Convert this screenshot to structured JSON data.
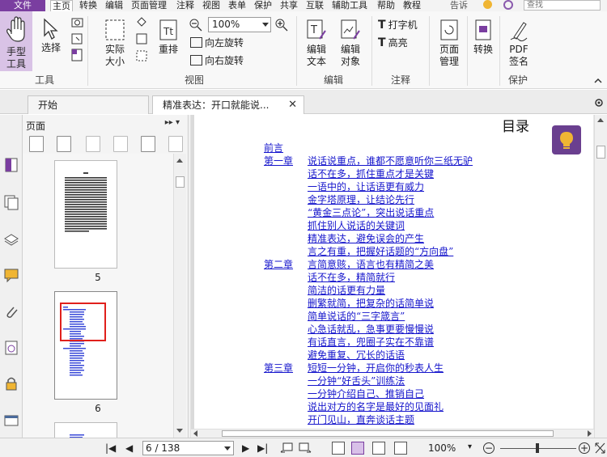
{
  "menubar": {
    "file": "文件",
    "items": [
      "主页",
      "转换",
      "编辑",
      "页面管理",
      "注释",
      "视图",
      "表单",
      "保护",
      "共享",
      "互联",
      "辅助工具",
      "帮助",
      "教程"
    ],
    "tell_me": "告诉",
    "search_placeholder": "查找"
  },
  "ribbon": {
    "hand_tool": "手型\n工具",
    "select": "选择",
    "actual_size": "实际\n大小",
    "reflow": "重排",
    "zoom_value": "100%",
    "rotate_left": "向左旋转",
    "rotate_right": "向右旋转",
    "edit_text": "编辑\n文本",
    "edit_object": "编辑\n对象",
    "typewriter": "打字机",
    "highlight": "高亮",
    "page_manage": "页面\n管理",
    "convert": "转换",
    "pdf_sign": "PDF\n签名",
    "groups": {
      "tools": "工具",
      "view": "视图",
      "edit": "编辑",
      "comment": "注释",
      "protect": "保护"
    }
  },
  "tabs": [
    {
      "label": "开始"
    },
    {
      "label": "精准表达：开口就能说..."
    }
  ],
  "panel": {
    "title": "页面",
    "controls": "▸▸ ▾",
    "thumbnails": [
      {
        "num": "5"
      },
      {
        "num": "6"
      }
    ]
  },
  "document": {
    "title": "目录",
    "toc": [
      {
        "chapter": "前言",
        "text": ""
      },
      {
        "chapter": "第一章",
        "text": "说话说重点，谁都不愿意听你三纸无驴"
      },
      {
        "chapter": "",
        "text": "话不在多，抓住重点才是关键"
      },
      {
        "chapter": "",
        "text": "一语中的，让话语更有威力"
      },
      {
        "chapter": "",
        "text": "金字塔原理，让结论先行"
      },
      {
        "chapter": "",
        "text": "“黄金三点论”，突出说话重点"
      },
      {
        "chapter": "",
        "text": "抓住别人说话的关键词"
      },
      {
        "chapter": "",
        "text": "精准表达，避免误会的产生"
      },
      {
        "chapter": "",
        "text": "言之有重，把握好话题的“方向盘”"
      },
      {
        "chapter": "第二章",
        "text": "言简意赅，语言也有精简之美"
      },
      {
        "chapter": "",
        "text": "话不在多，精简就行"
      },
      {
        "chapter": "",
        "text": "简洁的话更有力量"
      },
      {
        "chapter": "",
        "text": "删繁就简，把复杂的话简单说"
      },
      {
        "chapter": "",
        "text": "简单说话的“三字箴言”"
      },
      {
        "chapter": "",
        "text": "心急话就乱，急事更要慢慢说"
      },
      {
        "chapter": "",
        "text": "有话直言，兜圈子实在不靠谱"
      },
      {
        "chapter": "",
        "text": "避免重复、冗长的话语"
      },
      {
        "chapter": "第三章",
        "text": "短短一分钟，开启你的秒表人生"
      },
      {
        "chapter": "",
        "text": "一分钟“好舌头”训练法"
      },
      {
        "chapter": "",
        "text": "一分钟介绍自己、推销自己"
      },
      {
        "chapter": "",
        "text": "说出对方的名字是最好的见面礼"
      },
      {
        "chapter": "",
        "text": "开门见山，直奔谈话主题"
      }
    ]
  },
  "status": {
    "page": "6 / 138",
    "zoom": "100%"
  },
  "colors": {
    "accent": "#7a3ea0",
    "link": "#1515cc"
  }
}
